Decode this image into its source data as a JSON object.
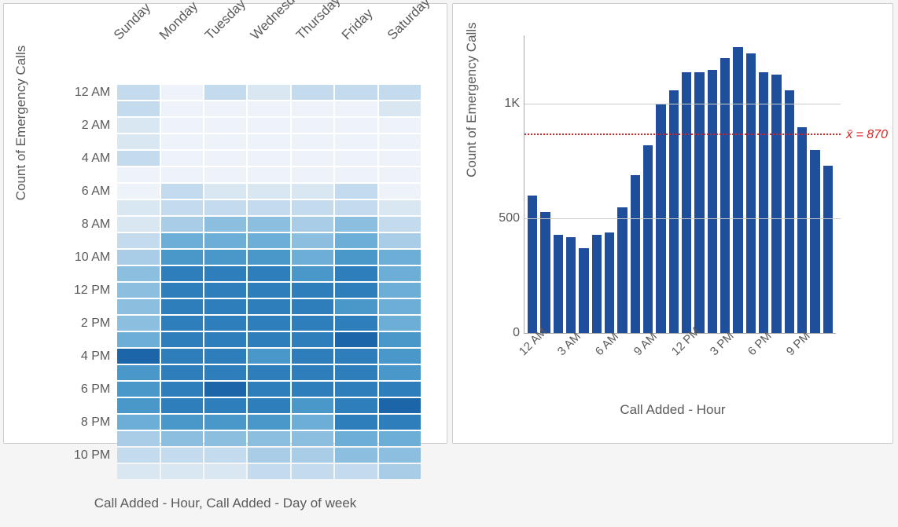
{
  "chart_data": [
    {
      "type": "heatmap",
      "title": "",
      "xlabel": "Call Added - Hour, Call Added - Day of week",
      "ylabel": "Count of Emergency Calls",
      "x_categories": [
        "Sunday",
        "Monday",
        "Tuesday",
        "Wednesday",
        "Thursday",
        "Friday",
        "Saturday"
      ],
      "y_categories": [
        "12 AM",
        "1 AM",
        "2 AM",
        "3 AM",
        "4 AM",
        "5 AM",
        "6 AM",
        "7 AM",
        "8 AM",
        "9 AM",
        "10 AM",
        "11 AM",
        "12 PM",
        "1 PM",
        "2 PM",
        "3 PM",
        "4 PM",
        "5 PM",
        "6 PM",
        "7 PM",
        "8 PM",
        "9 PM",
        "10 PM",
        "11 PM"
      ],
      "y_labels_shown": [
        "12 AM",
        "",
        "2 AM",
        "",
        "4 AM",
        "",
        "6 AM",
        "",
        "8 AM",
        "",
        "10 AM",
        "",
        "12 PM",
        "",
        "2 PM",
        "",
        "4 PM",
        "",
        "6 PM",
        "",
        "8 PM",
        "",
        "10 PM",
        ""
      ],
      "values": [
        [
          3,
          1,
          3,
          2,
          3,
          3,
          3
        ],
        [
          3,
          1,
          1,
          1,
          1,
          1,
          2
        ],
        [
          2,
          1,
          1,
          1,
          1,
          1,
          1
        ],
        [
          2,
          1,
          1,
          1,
          1,
          1,
          1
        ],
        [
          3,
          1,
          1,
          1,
          1,
          1,
          1
        ],
        [
          1,
          1,
          1,
          1,
          1,
          1,
          1
        ],
        [
          1,
          3,
          2,
          2,
          2,
          3,
          1
        ],
        [
          2,
          3,
          3,
          3,
          3,
          3,
          2
        ],
        [
          2,
          4,
          5,
          5,
          4,
          5,
          3
        ],
        [
          3,
          6,
          6,
          6,
          5,
          6,
          4
        ],
        [
          4,
          7,
          7,
          7,
          6,
          7,
          6
        ],
        [
          5,
          8,
          8,
          8,
          7,
          8,
          6
        ],
        [
          5,
          8,
          8,
          8,
          8,
          8,
          6
        ],
        [
          5,
          8,
          8,
          8,
          8,
          7,
          6
        ],
        [
          5,
          8,
          8,
          8,
          8,
          8,
          6
        ],
        [
          6,
          8,
          8,
          8,
          8,
          9,
          7
        ],
        [
          9,
          8,
          8,
          7,
          8,
          8,
          7
        ],
        [
          7,
          8,
          8,
          8,
          8,
          8,
          7
        ],
        [
          7,
          8,
          9,
          8,
          8,
          8,
          8
        ],
        [
          7,
          8,
          8,
          8,
          7,
          8,
          9
        ],
        [
          6,
          7,
          7,
          7,
          6,
          8,
          8
        ],
        [
          4,
          5,
          5,
          5,
          5,
          6,
          6
        ],
        [
          3,
          3,
          3,
          4,
          4,
          5,
          5
        ],
        [
          2,
          2,
          2,
          3,
          3,
          3,
          4
        ]
      ],
      "color_scale": {
        "min": 1,
        "max": 9,
        "note": "1 lightest, 9 darkest blue; approximate relative intensity"
      }
    },
    {
      "type": "bar",
      "title": "",
      "xlabel": "Call Added - Hour",
      "ylabel": "Count of Emergency Calls",
      "categories": [
        "12 AM",
        "1 AM",
        "2 AM",
        "3 AM",
        "4 AM",
        "5 AM",
        "6 AM",
        "7 AM",
        "8 AM",
        "9 AM",
        "10 AM",
        "11 AM",
        "12 PM",
        "1 PM",
        "2 PM",
        "3 PM",
        "4 PM",
        "5 PM",
        "6 PM",
        "7 PM",
        "8 PM",
        "9 PM",
        "10 PM",
        "11 PM"
      ],
      "x_ticks_shown": [
        "12 AM",
        "3 AM",
        "6 AM",
        "9 AM",
        "12 PM",
        "3 PM",
        "6 PM",
        "9 PM"
      ],
      "values": [
        600,
        530,
        430,
        420,
        370,
        430,
        440,
        550,
        690,
        820,
        1000,
        1060,
        1140,
        1140,
        1150,
        1200,
        1250,
        1220,
        1140,
        1130,
        1060,
        900,
        800,
        730
      ],
      "ylim": [
        0,
        1300
      ],
      "y_ticks": [
        0,
        500,
        1000
      ],
      "y_tick_labels": [
        "0",
        "500",
        "1K"
      ],
      "reference_line": {
        "value": 870,
        "label": "x̄ = 870",
        "color": "#e02020",
        "style": "dotted"
      }
    }
  ],
  "colors": {
    "bar_fill": "#1f4e9c",
    "heatmap_palette": [
      "#edf3f9",
      "#d9e7f2",
      "#c4dbed",
      "#a9cde6",
      "#8cbedf",
      "#6daed6",
      "#4a97c9",
      "#2e7ebc",
      "#1c65a8"
    ]
  }
}
